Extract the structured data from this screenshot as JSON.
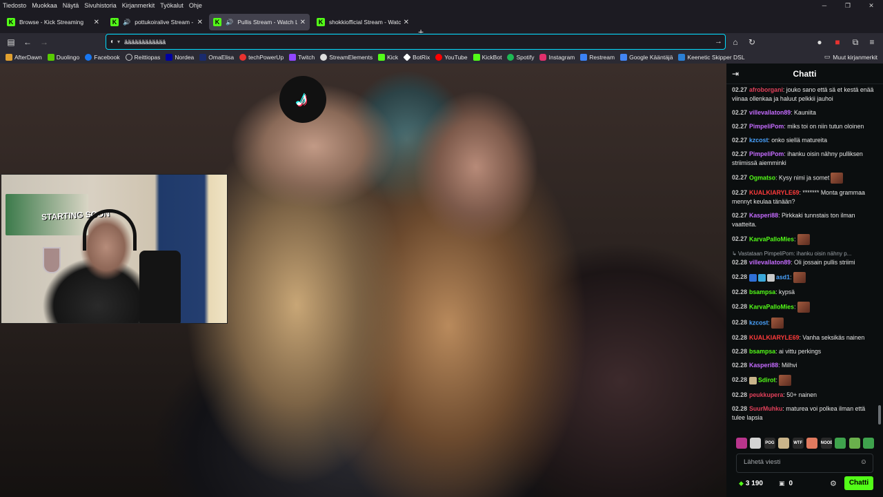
{
  "menubar": {
    "items": [
      "Tiedosto",
      "Muokkaa",
      "Näytä",
      "Sivuhistoria",
      "Kirjanmerkit",
      "Työkalut",
      "Ohje"
    ]
  },
  "tabs": [
    {
      "title": "Browse - Kick Streaming",
      "audio": false,
      "active": false
    },
    {
      "title": "pottukoiralive Stream - Wat",
      "audio": true,
      "active": false
    },
    {
      "title": "Pullis Stream - Watch Live o",
      "audio": true,
      "active": true
    },
    {
      "title": "shokkiofficial Stream - Watc",
      "audio": false,
      "active": false
    }
  ],
  "urlbar": {
    "value": "ääääääääääää"
  },
  "bookmarks": [
    {
      "label": "AfterDawn",
      "color": "#e0a030"
    },
    {
      "label": "Duolingo",
      "color": "#58cc02"
    },
    {
      "label": "Facebook",
      "color": "#1877f2"
    },
    {
      "label": "Reittiopas",
      "color": "#cccccc"
    },
    {
      "label": "Nordea",
      "color": "#0000a0"
    },
    {
      "label": "OmaElisa",
      "color": "#1a2b6d"
    },
    {
      "label": "techPowerUp",
      "color": "#e8322f"
    },
    {
      "label": "Twitch",
      "color": "#9146ff"
    },
    {
      "label": "StreamElements",
      "color": "#dddddd"
    },
    {
      "label": "Kick",
      "color": "#53fc18"
    },
    {
      "label": "BotRix",
      "color": "#ffffff"
    },
    {
      "label": "YouTube",
      "color": "#ff0000"
    },
    {
      "label": "KickBot",
      "color": "#53fc18"
    },
    {
      "label": "Spotify",
      "color": "#1db954"
    },
    {
      "label": "Instagram",
      "color": "#e1306c"
    },
    {
      "label": "Restream",
      "color": "#3b82f6"
    },
    {
      "label": "Google Kääntäjä",
      "color": "#4285f4"
    },
    {
      "label": "Keenetic Skipper DSL",
      "color": "#2a7fd4"
    }
  ],
  "other_bookmarks": "Muut kirjanmerkit",
  "stream": {
    "webcam_poster_text": "STARTING SOON"
  },
  "chat": {
    "title": "Chatti",
    "messages": [
      {
        "time": "02.27",
        "user": "afroborgani",
        "color": "#e0405a",
        "text": ": jouko sano että sä et kestä enää viinaa ollenkaa ja haluut pelkkii jauhoi"
      },
      {
        "time": "02.27",
        "user": "villevallaton89",
        "color": "#c56bff",
        "text": ": Kauniita"
      },
      {
        "time": "02.27",
        "user": "PimpeliPom",
        "color": "#c56bff",
        "text": ": miks toi on niin tutun oloinen"
      },
      {
        "time": "02.27",
        "user": "kzcost",
        "color": "#4aa3ff",
        "text": ": onko siellä matureita"
      },
      {
        "time": "02.27",
        "user": "PimpeliPom",
        "color": "#c56bff",
        "text": ": ihanku oisin nähny pulliksen striimissä aiemminki"
      },
      {
        "time": "02.27",
        "user": "Ogmatso",
        "color": "#53fc18",
        "text": ": Kysy nimi ja somet",
        "emote": true
      },
      {
        "time": "02.27",
        "user": "KUALKIARYLE69",
        "color": "#ff3b3b",
        "text": ": ******* Monta grammaa mennyt keulaa tänään?"
      },
      {
        "time": "02.27",
        "user": "Kasperi88",
        "color": "#c56bff",
        "text": ": Pirkkaki tunnstais ton ilman vaatteita."
      },
      {
        "time": "02.27",
        "user": "KarvaPalloMies",
        "color": "#53fc18",
        "text": ":",
        "emote": true
      },
      {
        "reply": "↳ Vastataan PimpeliPom: ihanku oisin nähny p...",
        "time": "02.28",
        "user": "villevallaton89",
        "color": "#c56bff",
        "text": ": Oli jossain pullis striimi"
      },
      {
        "time": "02.28",
        "user": "asd1",
        "color": "#4aa3ff",
        "text": ":",
        "badges": true,
        "emote": true
      },
      {
        "time": "02.28",
        "user": "bsampsa",
        "color": "#53fc18",
        "text": ": kypsä"
      },
      {
        "time": "02.28",
        "user": "KarvaPalloMies",
        "color": "#53fc18",
        "text": ":",
        "emote": true
      },
      {
        "time": "02.28",
        "user": "kzcost",
        "color": "#4aa3ff",
        "text": ":",
        "emote": true
      },
      {
        "time": "02.28",
        "user": "KUALKIARYLE69",
        "color": "#ff3b3b",
        "text": ": Vanha seksikäs nainen"
      },
      {
        "time": "02.28",
        "user": "bsampsa",
        "color": "#53fc18",
        "text": ": ai vittu perkings"
      },
      {
        "time": "02.28",
        "user": "Kasperi88",
        "color": "#c56bff",
        "text": ": Milhvi"
      },
      {
        "time": "02.28",
        "user": "Sdirot",
        "color": "#53fc18",
        "text": ":",
        "badge_one": true,
        "emote": true
      },
      {
        "time": "02.28",
        "user": "peukkupera",
        "color": "#e0405a",
        "text": ": 50+ nainen"
      },
      {
        "time": "02.28",
        "user": "SuurMuhku",
        "color": "#e0405a",
        "text": ": maturea voi polkea ilman että tulee lapsia"
      }
    ],
    "emote_bar": [
      "",
      "",
      "POG",
      "",
      "WTF",
      "",
      "NOOB",
      "",
      "",
      ""
    ],
    "input_placeholder": "Lähetä viesti",
    "points": "3 190",
    "gifts": "0",
    "send_label": "Chatti"
  }
}
